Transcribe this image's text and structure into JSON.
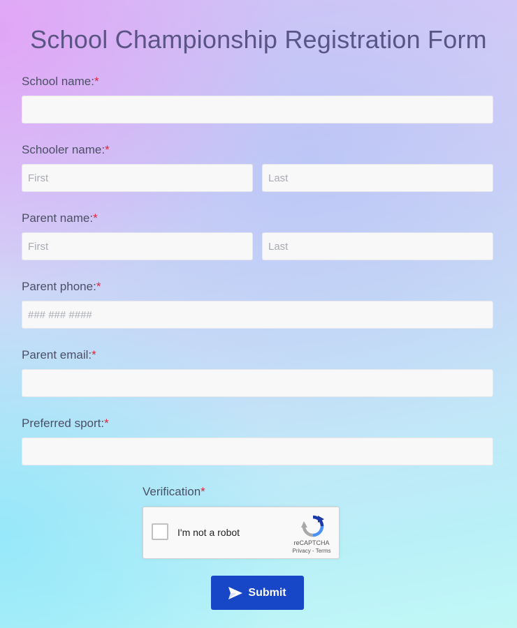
{
  "form": {
    "title": "School Championship Registration Form",
    "required_mark": "*",
    "school_name": {
      "label": "School name:",
      "value": ""
    },
    "schooler_name": {
      "label": "Schooler name:",
      "first_placeholder": "First",
      "last_placeholder": "Last"
    },
    "parent_name": {
      "label": "Parent name:",
      "first_placeholder": "First",
      "last_placeholder": "Last"
    },
    "parent_phone": {
      "label": "Parent phone:",
      "placeholder": "### ### ####"
    },
    "parent_email": {
      "label": "Parent email:",
      "value": ""
    },
    "preferred_sport": {
      "label": "Preferred sport:",
      "value": ""
    },
    "verification": {
      "label": "Verification",
      "checkbox_label": "I'm not a robot",
      "brand": "reCAPTCHA",
      "links": "Privacy - Terms",
      "icon": "recaptcha-icon"
    },
    "submit": {
      "label": "Submit",
      "icon": "send-icon",
      "color": "#1746c7"
    }
  },
  "colors": {
    "required": "#e0243c",
    "title": "#5a5585"
  }
}
